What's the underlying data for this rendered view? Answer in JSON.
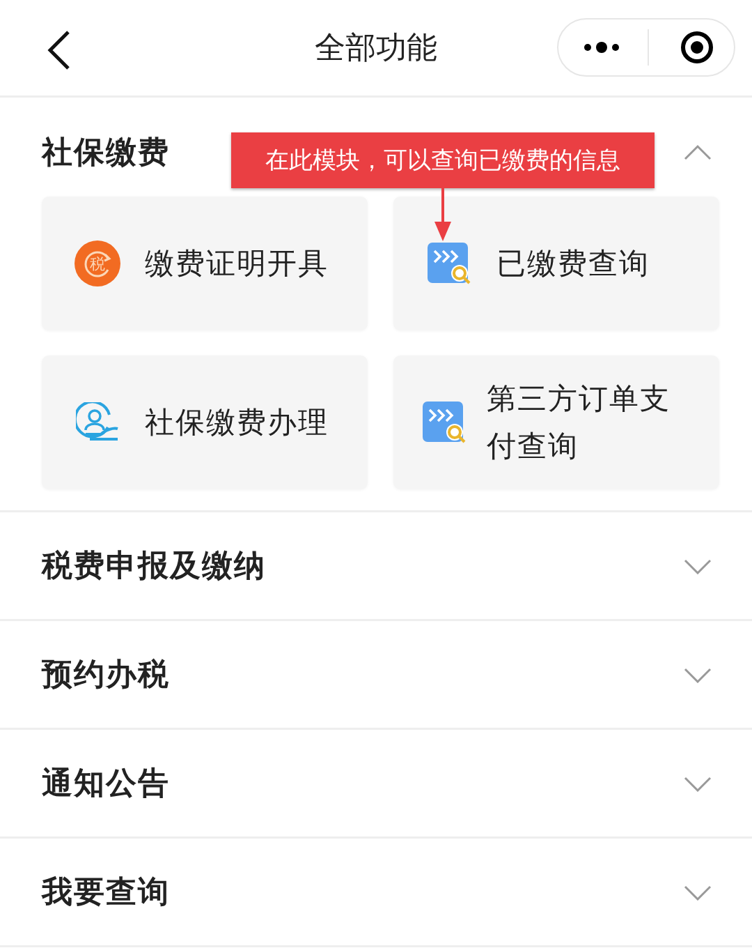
{
  "header": {
    "title": "全部功能"
  },
  "callout": {
    "text": "在此模块，可以查询已缴费的信息"
  },
  "sections": [
    {
      "title": "社保缴费",
      "expanded": true,
      "items": [
        {
          "kind": "certificate",
          "icon_text": "税",
          "label": "缴费证明开具"
        },
        {
          "kind": "query",
          "label": "已缴费查询"
        },
        {
          "kind": "person",
          "label": "社保缴费办理"
        },
        {
          "kind": "query",
          "label": "第三方订单支付查询"
        }
      ]
    },
    {
      "title": "税费申报及缴纳",
      "expanded": false
    },
    {
      "title": "预约办税",
      "expanded": false
    },
    {
      "title": "通知公告",
      "expanded": false
    },
    {
      "title": "我要查询",
      "expanded": false
    }
  ]
}
